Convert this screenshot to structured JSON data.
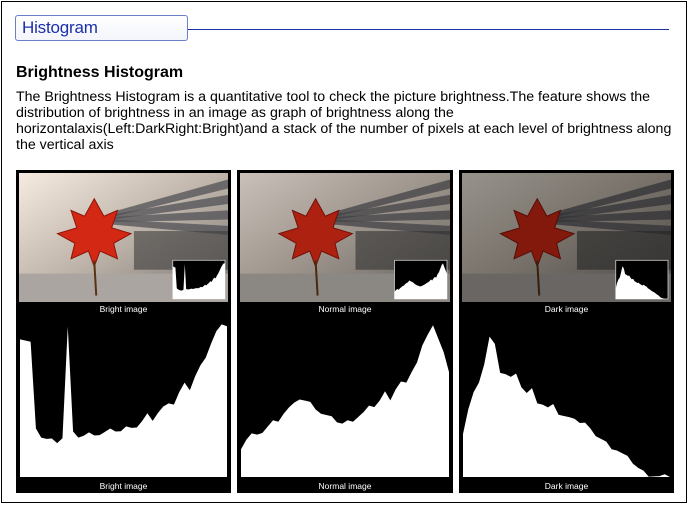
{
  "header": {
    "tab_label": "Histogram"
  },
  "section": {
    "title": "Brightness Histogram",
    "description": "The Brightness Histogram is a quantitative tool to check the picture brightness.The feature shows the distribution of brightness in an image as graph of brightness along the horizontalaxis(Left:DarkRight:Bright)and a stack of the number of pixels at each level of brightness along the vertical axis"
  },
  "photos": [
    {
      "caption": "Bright image"
    },
    {
      "caption": "Normal image"
    },
    {
      "caption": "Dark image"
    }
  ],
  "histograms": [
    {
      "caption": "Bright image"
    },
    {
      "caption": "Normal image"
    },
    {
      "caption": "Dark image"
    }
  ]
}
